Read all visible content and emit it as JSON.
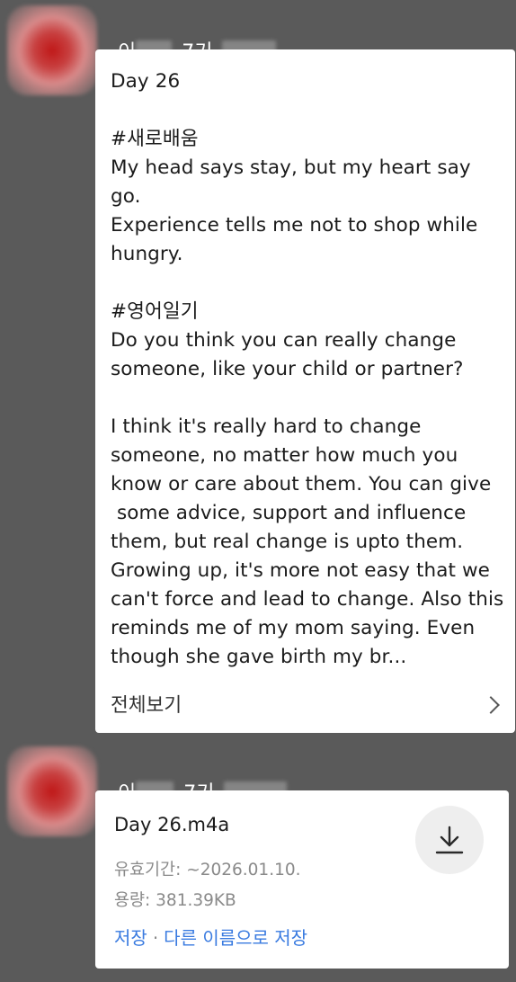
{
  "messages": [
    {
      "sender": {
        "prefix": "이",
        "suffix": "_7기"
      },
      "text": "Day 26\n\n#새로배움\nMy head says stay, but my heart say go.\nExperience tells me not to shop while hungry.\n\n#영어일기\nDo you think you can really change someone, like your child or partner?\n\nI think it's really hard to change someone, no matter how much you know or care about them. You can give\n some advice, support and influence them, but real change is upto them. Growing up, it's more not easy that we can't force and lead to change. Also this reminds me of my mom saying. Even though she gave birth my br...",
      "view_all_label": "전체보기",
      "icons": {
        "avatar": "avatar-blurred",
        "chevron": "chevron-right-icon"
      }
    },
    {
      "sender": {
        "prefix": "이",
        "suffix": "_7기"
      },
      "file": {
        "name": "Day 26.m4a",
        "expiry_label": "유효기간: ~2026.01.10.",
        "size_label": "용량: 381.39KB",
        "save_label": "저장",
        "separator": "·",
        "save_as_label": "다른 이름으로 저장"
      },
      "icons": {
        "avatar": "avatar-blurred",
        "download": "download-icon"
      }
    }
  ],
  "colors": {
    "background": "#5a5a5a",
    "bubble": "#ffffff",
    "link": "#3a7be0",
    "meta_text": "#8a8a8a"
  }
}
